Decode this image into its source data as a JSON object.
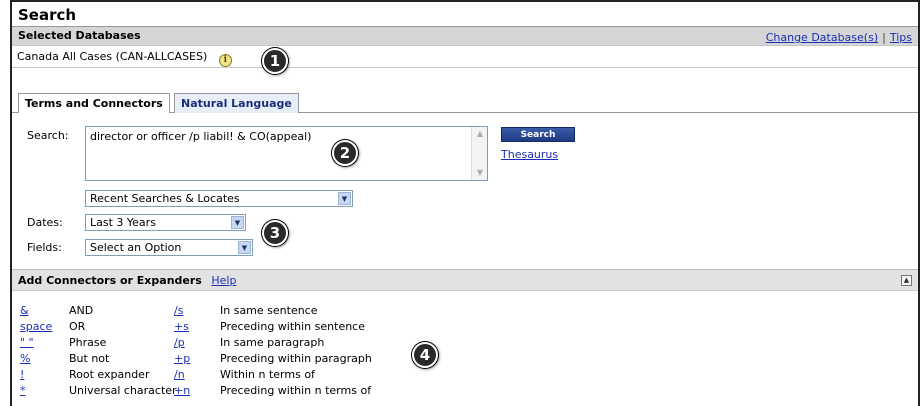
{
  "title": "Search",
  "selected_databases": {
    "label": "Selected Databases",
    "change_link": "Change Database(s)",
    "separator": "|",
    "tips_link": "Tips",
    "database_name": "Canada All Cases (CAN-ALLCASES)",
    "info_icon_glyph": "i"
  },
  "tabs": [
    {
      "label": "Terms and Connectors",
      "active": true
    },
    {
      "label": "Natural Language",
      "active": false
    }
  ],
  "form": {
    "search_label": "Search:",
    "search_value": "director or officer /p liabil! & CO(appeal)",
    "search_button": "Search",
    "thesaurus_link": "Thesaurus",
    "recent_select": "Recent Searches & Locates",
    "dates_label": "Dates:",
    "dates_select": "Last 3 Years",
    "fields_label": "Fields:",
    "fields_select": "Select an Option"
  },
  "connectors_section": {
    "title": "Add Connectors or Expanders",
    "help_link": "Help",
    "rows": [
      {
        "sym1": "&",
        "desc1": "AND",
        "sym2": "/s",
        "desc2": "In same sentence"
      },
      {
        "sym1": "space",
        "desc1": "OR",
        "sym2": "+s",
        "desc2": "Preceding within sentence"
      },
      {
        "sym1": "\" \"",
        "desc1": "Phrase",
        "sym2": "/p",
        "desc2": "In same paragraph"
      },
      {
        "sym1": "%",
        "desc1": "But not",
        "sym2": "+p",
        "desc2": "Preceding within paragraph"
      },
      {
        "sym1": "!",
        "desc1": "Root expander",
        "sym2": "/n",
        "desc2": "Within n terms of"
      },
      {
        "sym1": "*",
        "desc1": "Universal character",
        "sym2": "+n",
        "desc2": "Preceding within n terms of"
      }
    ]
  },
  "callouts": [
    "1",
    "2",
    "3",
    "4"
  ],
  "icons": {
    "info": "info-icon",
    "dropdown": "chevron-down-icon",
    "collapse": "collapse-icon"
  },
  "colors": {
    "link": "#1a2fb5",
    "search_button": "#2a4a98",
    "section_bar": "#d6d6d6",
    "callout": "#2a2a2a"
  }
}
